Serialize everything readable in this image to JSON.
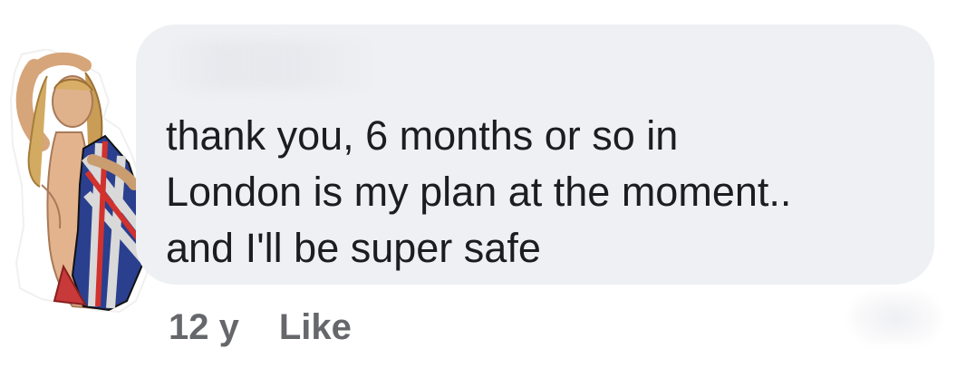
{
  "comment": {
    "text": "thank you, 6 months or so in\nLondon is my plan at the moment..\nand I'll be super safe",
    "timestamp": "12 y",
    "like_label": "Like"
  },
  "colors": {
    "bubble_bg": "#eff0f4",
    "text": "#1c1d21",
    "meta_text": "#65676b"
  }
}
